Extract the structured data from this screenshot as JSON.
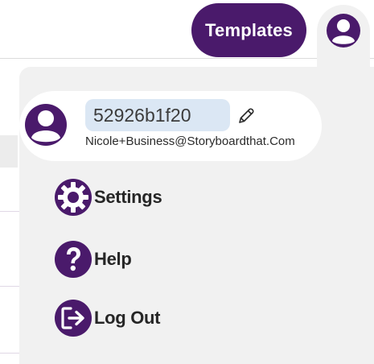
{
  "header": {
    "templates_label": "Templates",
    "avatar_icon": "user-avatar-icon"
  },
  "profile": {
    "username": "52926b1f20",
    "email": "Nicole+Business@Storyboardthat.Com",
    "edit_icon": "pencil-icon"
  },
  "menu": {
    "items": [
      {
        "label": "Settings",
        "icon": "gear-icon"
      },
      {
        "label": "Help",
        "icon": "question-icon"
      },
      {
        "label": "Log Out",
        "icon": "logout-icon"
      }
    ]
  },
  "colors": {
    "brand_purple": "#4a1a6b",
    "dropdown_bg": "#f1f1f1",
    "username_field_bg": "#dbe7f4"
  }
}
